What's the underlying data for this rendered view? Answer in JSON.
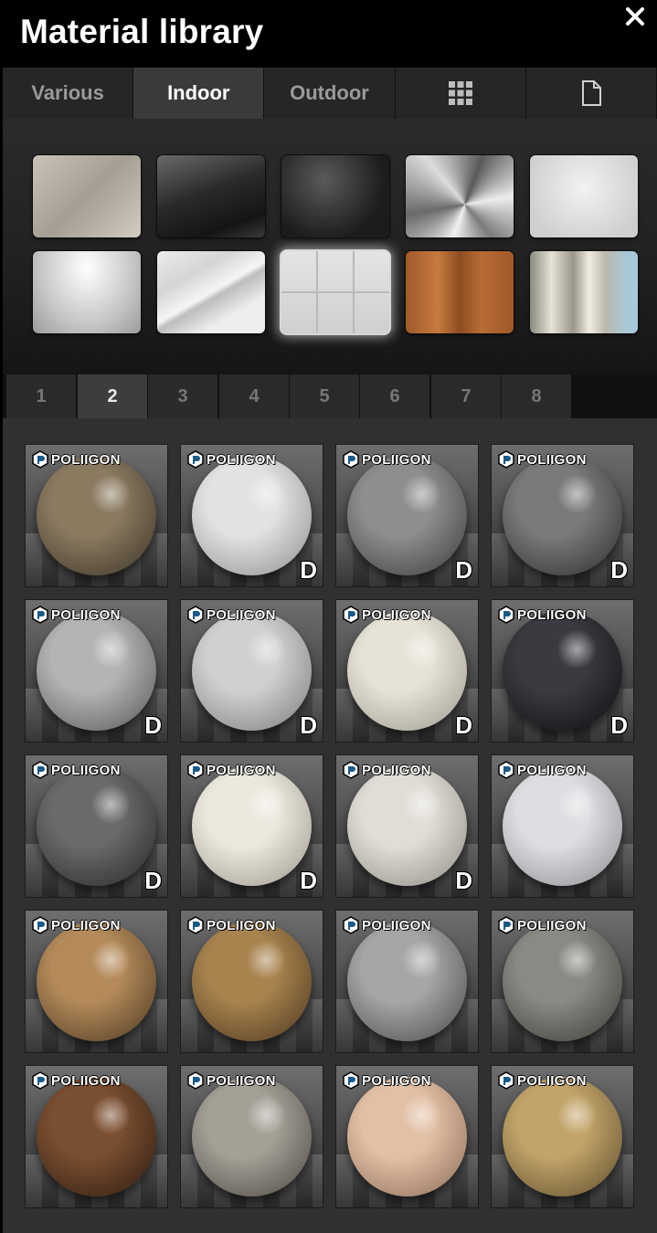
{
  "window": {
    "title": "Material library"
  },
  "category_tabs": [
    {
      "label": "Various",
      "active": false
    },
    {
      "label": "Indoor",
      "active": true
    },
    {
      "label": "Outdoor",
      "active": false
    },
    {
      "icon": "grid-icon"
    },
    {
      "icon": "document-icon"
    }
  ],
  "quick_materials": [
    {
      "name": "fabric-swatch",
      "fill": "linear-gradient(135deg,#c9c3b8,#a59e92 50%,#d2ccc2)"
    },
    {
      "name": "dark-glossy-swatch",
      "fill": "linear-gradient(160deg,#6a6a6a,#2a2a2a 45%,#141414 80%,#3a3a3a)"
    },
    {
      "name": "leather-swatch",
      "fill": "radial-gradient(circle at 40% 30%,#5a5a5a,#1c1c1c 70%)"
    },
    {
      "name": "brushed-metal-swatch",
      "fill": "conic-gradient(from 200deg at 55% 60%,#f0f0f0,#6a6a6a,#dcdcdc,#5a5a5a,#ececec,#7a7a7a,#f0f0f0)"
    },
    {
      "name": "stucco-swatch",
      "fill": "radial-gradient(circle at 50% 40%,#f2f2f2,#cfcfcf 80%)"
    },
    {
      "name": "white-gloss-swatch",
      "fill": "radial-gradient(ellipse at 50% 20%,#ffffff,#c7c7c7 60%,#9a9a9a)"
    },
    {
      "name": "marble-swatch",
      "fill": "linear-gradient(150deg,#ececec,#d5d5d5 30%,#f5f5f5 50%,#bdbdbd 55%,#eeeeee 75%)"
    },
    {
      "name": "white-tile-swatch",
      "fill": "#dadada"
    },
    {
      "name": "wood-parquet-swatch",
      "fill": "linear-gradient(90deg,#a05a2a,#c67a3e 30%,#8e4c22 50%,#b86c34 70%,#a0582a)"
    },
    {
      "name": "curtain-swatch",
      "fill": "linear-gradient(90deg,#8a8a80,#e6e2d6 20%,#9a968c 40%,#f0ece0 55%,#bcb8ac 70%,#a7c8d8 90%)"
    }
  ],
  "pages": [
    "1",
    "2",
    "3",
    "4",
    "5",
    "6",
    "7",
    "8"
  ],
  "active_page": "2",
  "brand_label": "POLIIGON",
  "download_badge": "D",
  "materials": [
    {
      "tone": "#8a7a60",
      "shade": "#3a3226",
      "downloadable": false
    },
    {
      "tone": "#e2e2e2",
      "shade": "#8c8c8c",
      "downloadable": true
    },
    {
      "tone": "#8e8e8e",
      "shade": "#3a3a3a",
      "downloadable": true
    },
    {
      "tone": "#7a7a7a",
      "shade": "#2c2c2c",
      "downloadable": true
    },
    {
      "tone": "#b4b4b4",
      "shade": "#555555",
      "downloadable": true
    },
    {
      "tone": "#d0d0d0",
      "shade": "#7a7a7a",
      "downloadable": true
    },
    {
      "tone": "#e6e2d6",
      "shade": "#9c988c",
      "downloadable": true
    },
    {
      "tone": "#3a3a40",
      "shade": "#0c0c10",
      "downloadable": true
    },
    {
      "tone": "#6a6a6a",
      "shade": "#262626",
      "downloadable": true
    },
    {
      "tone": "#ece8de",
      "shade": "#9a968c",
      "downloadable": true
    },
    {
      "tone": "#e0ddd6",
      "shade": "#8e8b84",
      "downloadable": true
    },
    {
      "tone": "#dedee2",
      "shade": "#8a8a90",
      "downloadable": false
    },
    {
      "tone": "#b48a5a",
      "shade": "#4a3620",
      "downloadable": false
    },
    {
      "tone": "#a8834e",
      "shade": "#4a361e",
      "downloadable": false
    },
    {
      "tone": "#a6a6a6",
      "shade": "#484848",
      "downloadable": false
    },
    {
      "tone": "#8a8a84",
      "shade": "#3a3a36",
      "downloadable": false
    },
    {
      "tone": "#7a4e30",
      "shade": "#2c1a10",
      "downloadable": false
    },
    {
      "tone": "#a4a096",
      "shade": "#4a4640",
      "downloadable": false
    },
    {
      "tone": "#e2c0a6",
      "shade": "#8a6a54",
      "downloadable": false
    },
    {
      "tone": "#c2a46a",
      "shade": "#5a4a2a",
      "downloadable": false
    }
  ]
}
